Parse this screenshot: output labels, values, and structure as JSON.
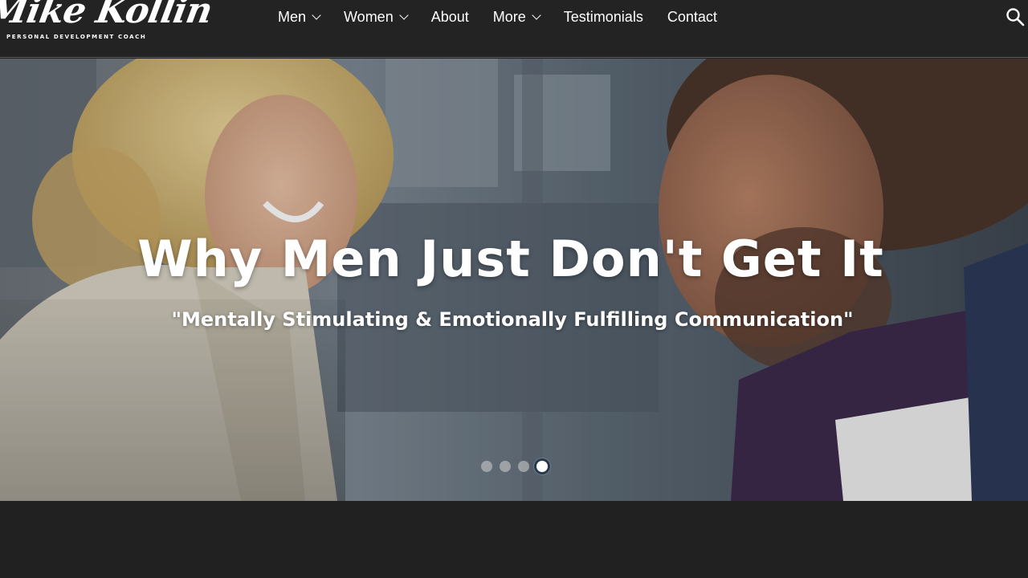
{
  "brand": {
    "name": "Mike Kollin",
    "tagline": "PERSONAL DEVELOPMENT COACH"
  },
  "nav": {
    "items": [
      {
        "label": "Men",
        "has_dropdown": true
      },
      {
        "label": "Women",
        "has_dropdown": true
      },
      {
        "label": "About",
        "has_dropdown": false
      },
      {
        "label": "More",
        "has_dropdown": true
      },
      {
        "label": "Testimonials",
        "has_dropdown": false
      },
      {
        "label": "Contact",
        "has_dropdown": false
      }
    ],
    "search_icon": "search-icon"
  },
  "hero": {
    "title": "Why Men Just Don't Get It",
    "subtitle": "\"Mentally Stimulating & Emotionally Fulfilling Communication\"",
    "slides_total": 4,
    "active_slide": 4
  },
  "colors": {
    "header_bg": "#232323",
    "page_bg": "#212121",
    "text": "#ffffff"
  }
}
